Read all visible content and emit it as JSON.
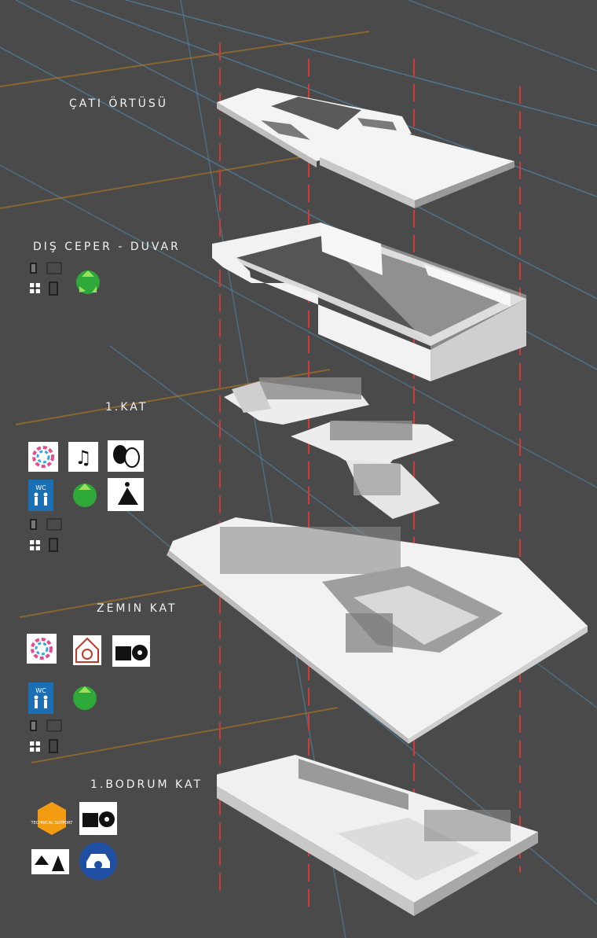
{
  "layers": [
    {
      "id": "roof",
      "title": "ÇATI ÖRTÜSÜ"
    },
    {
      "id": "facade",
      "title": "DIŞ CEPER - DUVAR"
    },
    {
      "id": "first_floor",
      "title": "1.KAT"
    },
    {
      "id": "ground_floor",
      "title": "ZEMIN KAT"
    },
    {
      "id": "basement",
      "title": "1.BODRUM KAT"
    }
  ],
  "icons": {
    "wc": "WC",
    "technical_support": "TECHNICAL SUPPORT"
  },
  "colors": {
    "background": "#4a4a4a",
    "axis_red": "#d23a3a",
    "blue_line": "#4f86a8",
    "orange_line": "#b07a20",
    "model": "#f4f4f4",
    "model_shade": "#bdbdbd"
  }
}
